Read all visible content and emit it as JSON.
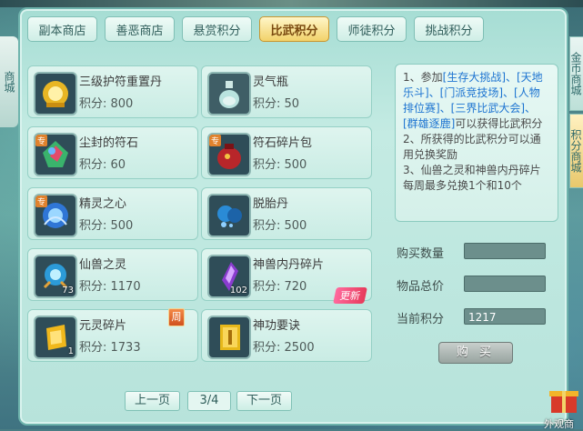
{
  "tabs": [
    {
      "label": "副本商店",
      "active": false
    },
    {
      "label": "善恶商店",
      "active": false
    },
    {
      "label": "悬赏积分",
      "active": false
    },
    {
      "label": "比武积分",
      "active": true
    },
    {
      "label": "师徒积分",
      "active": false
    },
    {
      "label": "挑战积分",
      "active": false
    }
  ],
  "items": [
    {
      "name": "三级护符重置丹",
      "price": "积分: 800",
      "icon": "golden-amulet-icon"
    },
    {
      "name": "灵气瓶",
      "price": "积分: 50",
      "icon": "spirit-bottle-icon"
    },
    {
      "name": "尘封的符石",
      "price": "积分: 60",
      "icon": "rune-stone-icon",
      "badge": "专"
    },
    {
      "name": "符石碎片包",
      "price": "积分: 500",
      "icon": "rune-shard-bag-icon",
      "badge": "专"
    },
    {
      "name": "精灵之心",
      "price": "积分: 500",
      "icon": "spirit-heart-icon",
      "badge": "专"
    },
    {
      "name": "脱胎丹",
      "price": "积分: 500",
      "icon": "rebirth-pill-icon"
    },
    {
      "name": "仙兽之灵",
      "price": "积分: 1170",
      "icon": "beast-spirit-icon",
      "count": "73"
    },
    {
      "name": "神兽内丹碎片",
      "price": "积分: 720",
      "icon": "beast-core-shard-icon",
      "count": "102",
      "tag": "更新"
    },
    {
      "name": "元灵碎片",
      "price": "积分: 1733",
      "icon": "yuanling-shard-icon",
      "count": "1",
      "tag": "周"
    },
    {
      "name": "神功要诀",
      "price": "积分: 2500",
      "icon": "skill-book-icon"
    }
  ],
  "info": {
    "line1_a": "1、参加",
    "line1_links": "[生存大挑战]、[天地乐斗]、[门派竞技场]、[人物排位赛]、[三界比武大会]、[群雄逐鹿]",
    "line1_b": "可以获得比武积分",
    "line2": "2、所获得的比武积分可以通用兑换奖励",
    "line3": "3、仙兽之灵和神兽内丹碎片每周最多兑换1个和10个"
  },
  "form": {
    "qty_label": "购买数量",
    "total_label": "物品总价",
    "points_label": "当前积分",
    "qty_value": "",
    "total_value": "",
    "points_value": "1217",
    "buy_label": "购 买"
  },
  "pager": {
    "prev": "上一页",
    "page": "3/4",
    "next": "下一页"
  },
  "side": {
    "right_tab1": "金币商城",
    "right_tab2": "积分商城",
    "left_tab": "商城",
    "gift_label": "外观商"
  },
  "colors": {
    "active_tab": "#f2d26a",
    "link": "#1d74d1",
    "new_tag": "#e73a5a"
  }
}
